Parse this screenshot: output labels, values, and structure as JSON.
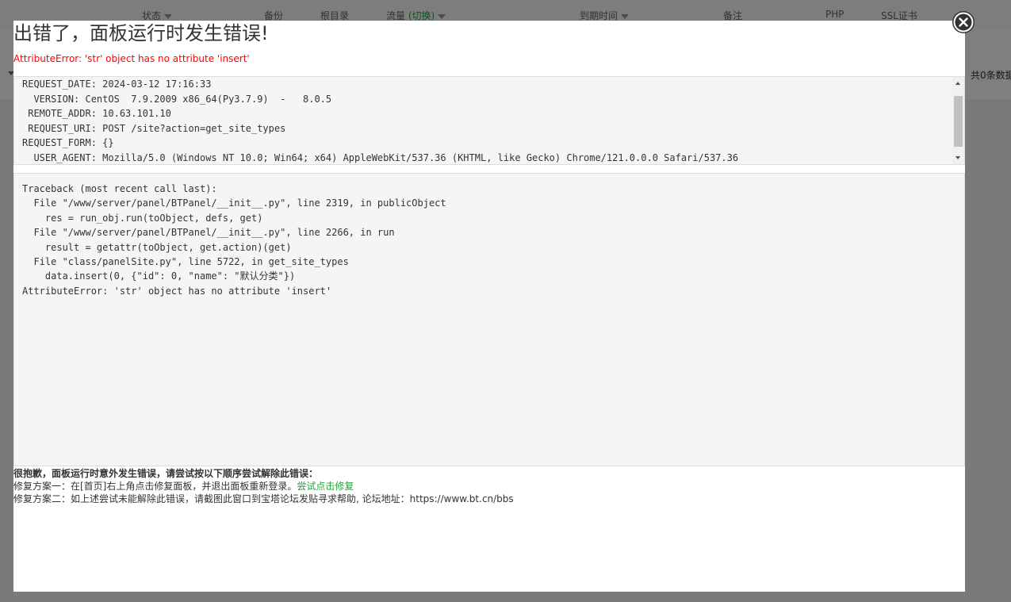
{
  "background": {
    "columns": [
      {
        "label": "状态",
        "sortable": true
      },
      {
        "label": "备份"
      },
      {
        "label": "根目录"
      },
      {
        "label": "流量",
        "extra": "(切换)",
        "sortable": true
      },
      {
        "label": "到期时间",
        "sortable": true
      },
      {
        "label": "备注"
      },
      {
        "label": "PHP"
      },
      {
        "label": "SSL证书"
      }
    ],
    "pager_text": "共0条数据"
  },
  "dialog": {
    "title": "出错了，面板运行时发生错误!",
    "error_message": "AttributeError: 'str' object has no attribute 'insert'",
    "request_info": [
      "REQUEST_DATE: 2024-03-12 17:16:33",
      "  VERSION: CentOS  7.9.2009 x86_64(Py3.7.9)  -   8.0.5",
      " REMOTE_ADDR: 10.63.101.10",
      " REQUEST_URI: POST /site?action=get_site_types",
      "REQUEST_FORM: {}",
      "  USER_AGENT: Mozilla/5.0 (Windows NT 10.0; Win64; x64) AppleWebKit/537.36 (KHTML, like Gecko) Chrome/121.0.0.0 Safari/537.36"
    ],
    "traceback": [
      "Traceback (most recent call last):",
      "  File \"/www/server/panel/BTPanel/__init__.py\", line 2319, in publicObject",
      "    res = run_obj.run(toObject, defs, get)",
      "  File \"/www/server/panel/BTPanel/__init__.py\", line 2266, in run",
      "    result = getattr(toObject, get.action)(get)",
      "  File \"class/panelSite.py\", line 5722, in get_site_types",
      "    data.insert(0, {\"id\": 0, \"name\": \"默认分类\"})",
      "AttributeError: 'str' object has no attribute 'insert'"
    ],
    "help": {
      "heading": "很抱歉，面板运行时意外发生错误，请尝试按以下顺序尝试解除此错误：",
      "option1": "修复方案一：在[首页]右上角点击修复面板，并退出面板重新登录。",
      "option1_link": "尝试点击修复",
      "option2": "修复方案二：如上述尝试未能解除此错误，请截图此窗口到宝塔论坛发贴寻求帮助, 论坛地址：https://www.bt.cn/bbs"
    }
  },
  "colors": {
    "accent_green": "#20a53a",
    "error_red": "#ff0000",
    "close_button": "#333333"
  },
  "icons": {
    "close": "close-icon",
    "sort": "sort-caret-icon"
  }
}
